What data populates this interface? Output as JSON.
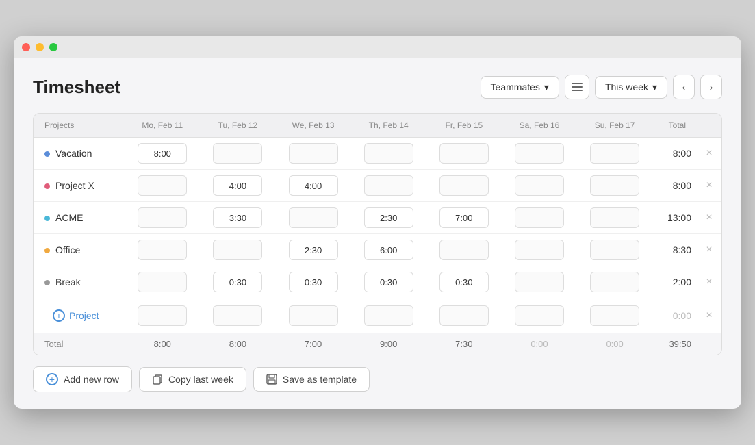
{
  "window": {
    "title": "Timesheet"
  },
  "header": {
    "title": "Timesheet",
    "teammates_label": "Teammates",
    "week_label": "This week"
  },
  "table": {
    "columns": {
      "projects": "Projects",
      "mon": "Mo, Feb 11",
      "tue": "Tu, Feb 12",
      "wed": "We, Feb 13",
      "thu": "Th, Feb 14",
      "fri": "Fr, Feb 15",
      "sat": "Sa, Feb 16",
      "sun": "Su, Feb 17",
      "total": "Total"
    },
    "rows": [
      {
        "name": "Vacation",
        "color": "#5b8dd9",
        "mon": "8:00",
        "tue": "",
        "wed": "",
        "thu": "",
        "fri": "",
        "sat": "",
        "sun": "",
        "total": "8:00"
      },
      {
        "name": "Project X",
        "color": "#e05c7a",
        "mon": "",
        "tue": "4:00",
        "wed": "4:00",
        "thu": "",
        "fri": "",
        "sat": "",
        "sun": "",
        "total": "8:00"
      },
      {
        "name": "ACME",
        "color": "#4ab8d8",
        "mon": "",
        "tue": "3:30",
        "wed": "",
        "thu": "2:30",
        "fri": "7:00",
        "sat": "",
        "sun": "",
        "total": "13:00"
      },
      {
        "name": "Office",
        "color": "#f0a940",
        "mon": "",
        "tue": "",
        "wed": "2:30",
        "thu": "6:00",
        "fri": "",
        "sat": "",
        "sun": "",
        "total": "8:30"
      },
      {
        "name": "Break",
        "color": "#999",
        "mon": "",
        "tue": "0:30",
        "wed": "0:30",
        "thu": "0:30",
        "fri": "0:30",
        "sat": "",
        "sun": "",
        "total": "2:00"
      }
    ],
    "add_project_label": "Project",
    "totals": {
      "label": "Total",
      "mon": "8:00",
      "tue": "8:00",
      "wed": "7:00",
      "thu": "9:00",
      "fri": "7:30",
      "sat": "0:00",
      "sun": "0:00",
      "total": "39:50"
    }
  },
  "footer": {
    "add_row_label": "Add new row",
    "copy_label": "Copy last week",
    "save_template_label": "Save as template"
  }
}
